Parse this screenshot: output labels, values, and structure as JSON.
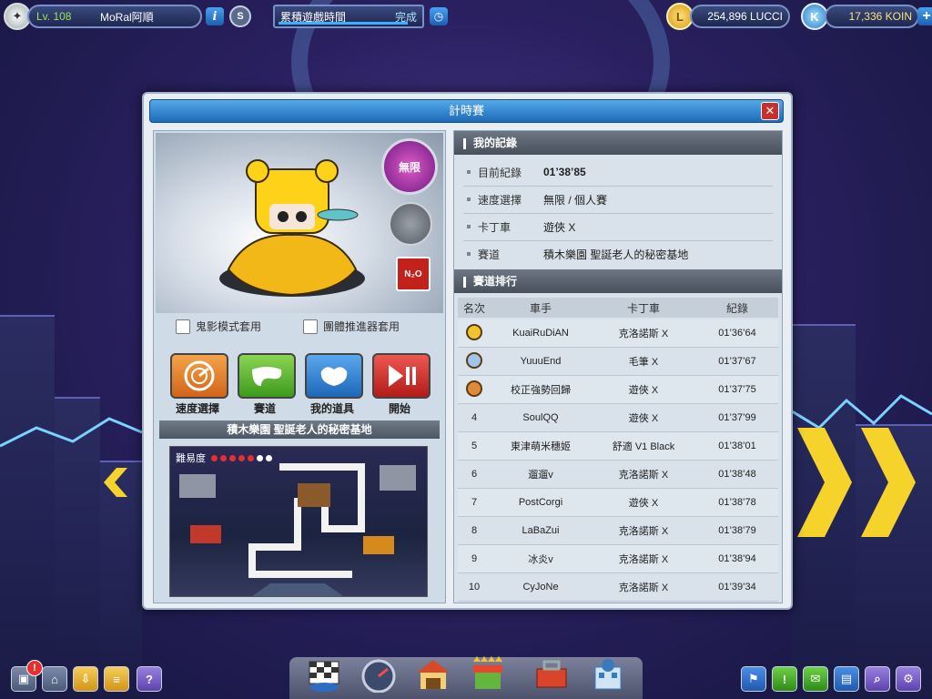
{
  "hud": {
    "level": "Lv. 108",
    "player_name": "MoRal阿順",
    "mission_label": "累積遊戲時間",
    "mission_status": "完成",
    "lucci": "254,896 LUCCI",
    "koin": "17,336 KOIN",
    "info_icon": "i",
    "s_icon": "S",
    "lucci_icon": "L",
    "koin_icon": "K",
    "add_icon": "+"
  },
  "dialog": {
    "title": "計時賽",
    "close": "✕"
  },
  "kart": {
    "speed_badge": "無限",
    "n2o_badge": "N₂O"
  },
  "options": {
    "ghost_mode": "鬼影模式套用",
    "team_booster": "團體推進器套用"
  },
  "buttons": {
    "speed_select": "速度選擇",
    "track": "賽道",
    "my_items": "我的道具",
    "start": "開始"
  },
  "track": {
    "banner": "積木樂園 聖誕老人的秘密基地",
    "difficulty_label": "難易度",
    "difficulty": 5,
    "difficulty_max": 7
  },
  "my_record": {
    "header": "我的記錄",
    "rows": [
      {
        "key": "目前紀錄",
        "value": "01’38’85"
      },
      {
        "key": "速度選擇",
        "value": "無限 / 個人賽"
      },
      {
        "key": "卡丁車",
        "value": "遊俠 X"
      },
      {
        "key": "賽道",
        "value": "積木樂園 聖誕老人的秘密基地"
      }
    ]
  },
  "ranking": {
    "header": "賽道排行",
    "columns": [
      "名次",
      "車手",
      "卡丁車",
      "紀錄"
    ],
    "rows": [
      {
        "rank": "",
        "medal": "gold",
        "driver": "KuaiRuDiAN",
        "kart": "克洛諾斯 X",
        "time": "01’36’64"
      },
      {
        "rank": "",
        "medal": "silver",
        "driver": "YuuuEnd",
        "kart": "毛筆 X",
        "time": "01’37’67"
      },
      {
        "rank": "",
        "medal": "bronze",
        "driver": "校正強勢回歸",
        "kart": "遊俠 X",
        "time": "01’37’75"
      },
      {
        "rank": "4",
        "medal": "",
        "driver": "SoulQQ",
        "kart": "遊俠 X",
        "time": "01’37’99"
      },
      {
        "rank": "5",
        "medal": "",
        "driver": "東津萌米穗姬",
        "kart": "舒適 V1 Black",
        "time": "01’38’01"
      },
      {
        "rank": "6",
        "medal": "",
        "driver": "遛遛v",
        "kart": "克洛諾斯 X",
        "time": "01’38’48"
      },
      {
        "rank": "7",
        "medal": "",
        "driver": "PostCorgi",
        "kart": "遊俠 X",
        "time": "01’38’78"
      },
      {
        "rank": "8",
        "medal": "",
        "driver": "LaBaZui",
        "kart": "克洛諾斯 X",
        "time": "01’38’79"
      },
      {
        "rank": "9",
        "medal": "",
        "driver": "冰炎v",
        "kart": "克洛諾斯 X",
        "time": "01’38’94"
      },
      {
        "rank": "10",
        "medal": "",
        "driver": "CyJoNe",
        "kart": "克洛諾斯 X",
        "time": "01’39’34"
      }
    ]
  },
  "bottom": {
    "alert_badge": "!",
    "help_icon": "?",
    "quest_icon": "!"
  },
  "colors": {
    "gold": "#f2c230",
    "silver": "#9fc6ea",
    "bronze": "#e08a3a",
    "title_blue": "#1d6ab7",
    "start_red": "#d9332e",
    "track_green": "#5cbc2e",
    "items_blue": "#2f86d6",
    "speed_orange": "#e9892a"
  }
}
